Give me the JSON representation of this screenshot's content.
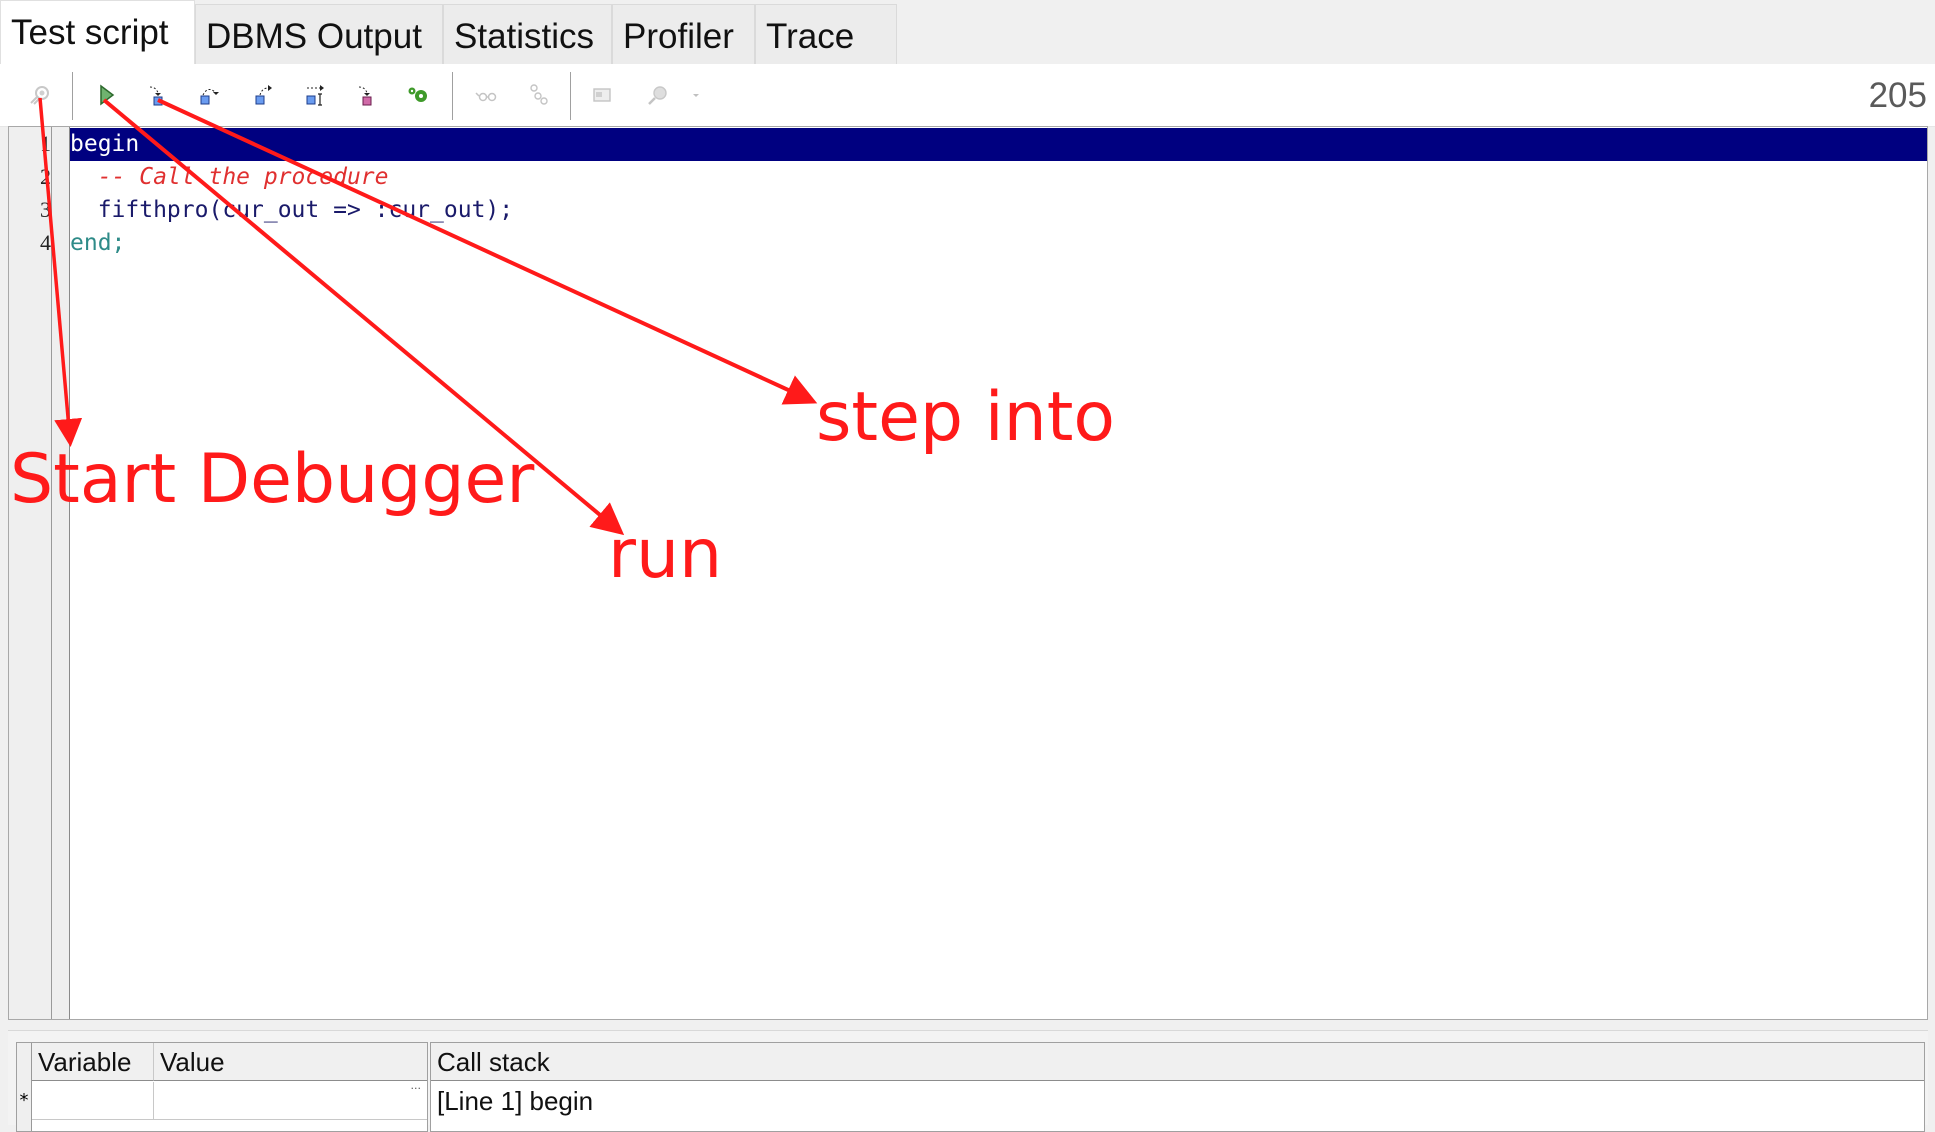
{
  "tabs": [
    {
      "label": "Test script",
      "active": true
    },
    {
      "label": "DBMS Output",
      "active": false
    },
    {
      "label": "Statistics",
      "active": false
    },
    {
      "label": "Profiler",
      "active": false
    },
    {
      "label": "Trace",
      "active": false
    }
  ],
  "toolbar": {
    "buttons": [
      {
        "name": "start-debugger",
        "icon": "debugger-icon",
        "enabled": false
      },
      {
        "name": "run",
        "icon": "run-icon",
        "enabled": true
      },
      {
        "name": "step-into",
        "icon": "step-into-icon",
        "enabled": true
      },
      {
        "name": "step-over",
        "icon": "step-over-icon",
        "enabled": true
      },
      {
        "name": "step-out",
        "icon": "step-out-icon",
        "enabled": true
      },
      {
        "name": "run-to-next-line",
        "icon": "run-to-line-icon",
        "enabled": true
      },
      {
        "name": "run-to-exception",
        "icon": "run-to-exception-icon",
        "enabled": true
      },
      {
        "name": "debug-options",
        "icon": "gear-icon",
        "enabled": true
      },
      {
        "name": "watch",
        "icon": "glasses-icon",
        "enabled": false
      },
      {
        "name": "toggle-breakpoint",
        "icon": "breakpoint-icon",
        "enabled": false
      },
      {
        "name": "view-output",
        "icon": "window-icon",
        "enabled": false
      },
      {
        "name": "find",
        "icon": "search-icon",
        "enabled": false
      }
    ],
    "counter": "205"
  },
  "editor": {
    "lines": [
      {
        "num": "1",
        "text": "begin",
        "kind": "keyword",
        "selected": true
      },
      {
        "num": "2",
        "text": "  -- Call the procedure",
        "kind": "comment",
        "selected": false
      },
      {
        "num": "3",
        "text": "  fifthpro(cur_out => :cur_out);",
        "kind": "code",
        "selected": false
      },
      {
        "num": "4",
        "text": "end;",
        "kind": "keyword",
        "selected": false
      }
    ]
  },
  "variables": {
    "headers": [
      "Variable",
      "Value"
    ],
    "new_row_marker": "*",
    "rows": [
      {
        "variable": "",
        "value": ""
      }
    ],
    "ellipsis": "..."
  },
  "callstack": {
    "header": "Call stack",
    "entries": [
      "[Line 1] begin"
    ]
  },
  "annotations": {
    "start_debugger": "Start Debugger",
    "run": "run",
    "step_into": "step into",
    "color": "#ff1a1a"
  }
}
